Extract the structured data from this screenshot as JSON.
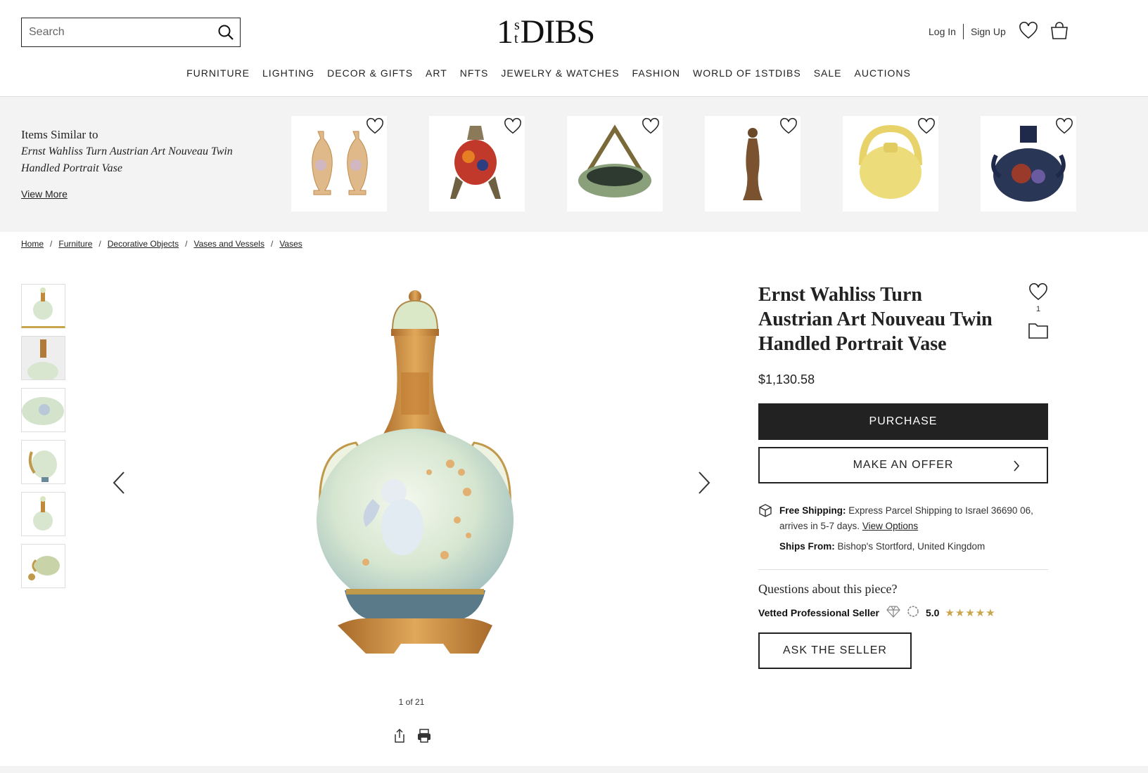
{
  "header": {
    "search_placeholder": "Search",
    "logo_one": "1",
    "logo_s": "s",
    "logo_t": "t",
    "logo_dibs": "DIBS",
    "login": "Log In",
    "signup": "Sign Up"
  },
  "nav": [
    "FURNITURE",
    "LIGHTING",
    "DECOR & GIFTS",
    "ART",
    "NFTS",
    "JEWELRY & WATCHES",
    "FASHION",
    "WORLD OF 1STDIBS",
    "SALE",
    "AUCTIONS"
  ],
  "similar": {
    "title": "Items Similar to",
    "subtitle": "Ernst Wahliss Turn Austrian Art Nouveau Twin Handled Portrait Vase",
    "view_more": "View More",
    "items": [
      "twin-vases",
      "footed-floral-vase",
      "handled-bowl",
      "figural-statue",
      "yellow-basket-vase",
      "floral-twin-handle-vase"
    ]
  },
  "breadcrumb": [
    "Home",
    "Furniture",
    "Decorative Objects",
    "Vases and Vessels",
    "Vases"
  ],
  "gallery": {
    "counter": "1 of 21",
    "thumb_count": 6
  },
  "product": {
    "title": "Ernst Wahliss Turn Austrian Art Nouveau Twin Handled Portrait Vase",
    "favorites_count": "1",
    "price": "$1,130.58",
    "purchase_label": "PURCHASE",
    "offer_label": "MAKE AN OFFER",
    "shipping_label": "Free Shipping:",
    "shipping_text": "Express Parcel Shipping to Israel 36690 06, arrives in 5-7 days.",
    "shipping_link": "View Options",
    "ships_from_label": "Ships From:",
    "ships_from_value": "Bishop's Stortford, United Kingdom",
    "questions": "Questions about this piece?",
    "seller_label": "Vetted Professional Seller",
    "rating": "5.0",
    "stars": "★★★★★",
    "ask_label": "ASK THE SELLER"
  },
  "colors": {
    "accent_gold": "#c9a54c",
    "dark": "#222222",
    "band": "#f3f3f3"
  }
}
